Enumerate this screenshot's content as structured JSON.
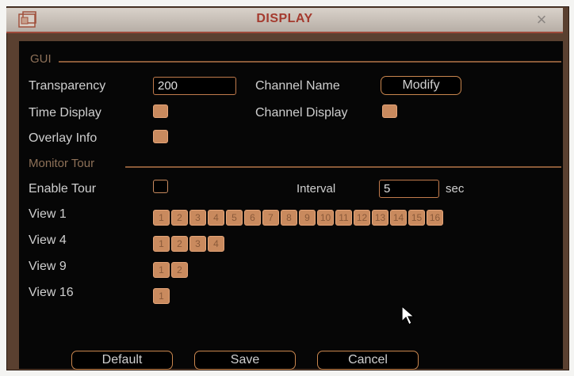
{
  "window": {
    "title": "DISPLAY"
  },
  "gui": {
    "section_label": "GUI",
    "transparency_label": "Transparency",
    "transparency_value": "200",
    "channel_name_label": "Channel Name",
    "modify_button": "Modify",
    "time_display_label": "Time Display",
    "time_display_checked": true,
    "channel_display_label": "Channel Display",
    "channel_display_checked": true,
    "overlay_info_label": "Overlay Info",
    "overlay_info_checked": true
  },
  "tour": {
    "section_label": "Monitor Tour",
    "enable_tour_label": "Enable Tour",
    "enable_tour_checked": false,
    "interval_label": "Interval",
    "interval_value": "5",
    "interval_unit": "sec",
    "view1_label": "View 1",
    "view1_channels": [
      "1",
      "2",
      "3",
      "4",
      "5",
      "6",
      "7",
      "8",
      "9",
      "10",
      "11",
      "12",
      "13",
      "14",
      "15",
      "16"
    ],
    "view4_label": "View 4",
    "view4_channels": [
      "1",
      "2",
      "3",
      "4"
    ],
    "view9_label": "View 9",
    "view9_channels": [
      "1",
      "2"
    ],
    "view16_label": "View 16",
    "view16_channels": [
      "1"
    ]
  },
  "buttons": {
    "default": "Default",
    "save": "Save",
    "cancel": "Cancel"
  },
  "icons": {
    "window": "window-icon",
    "close": "close-icon",
    "cursor": "mouse-pointer-icon"
  },
  "colors": {
    "accent": "#c98a5e",
    "title": "#a43a2e",
    "background": "#060606"
  }
}
